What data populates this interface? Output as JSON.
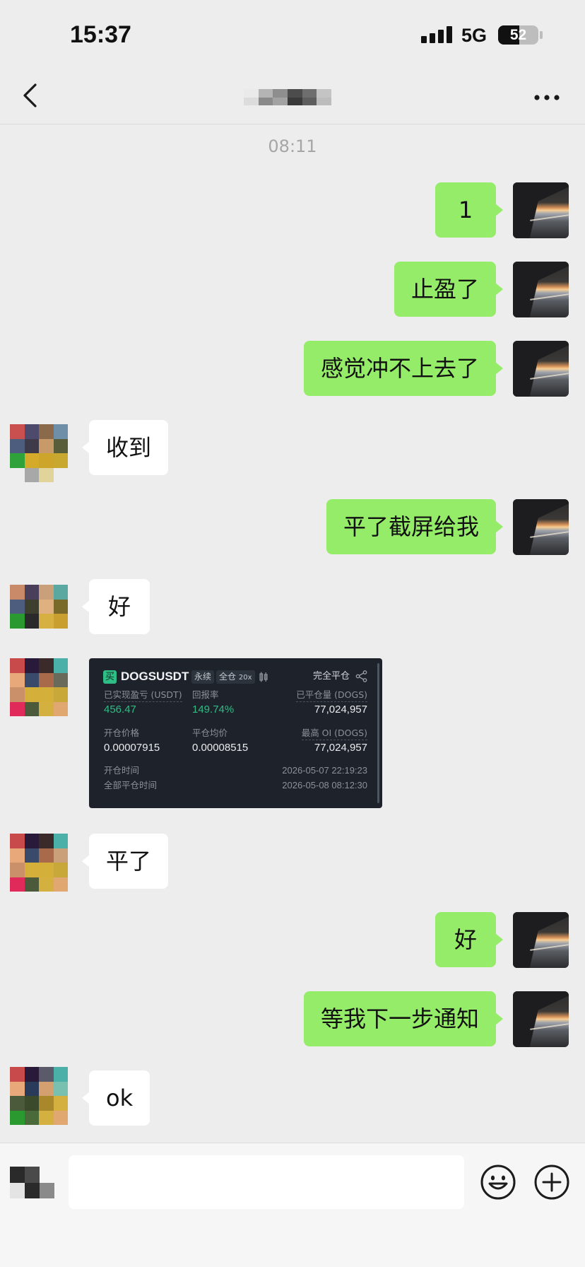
{
  "theme": {
    "background": "#ededed",
    "bubble_self": "#95ec69",
    "bubble_other": "#ffffff",
    "card_background": "#1e222a",
    "profit_color": "#2ebd85"
  },
  "status_bar": {
    "time": "15:37",
    "network": "5G",
    "battery": "52",
    "battery_level": 0.52
  },
  "nav": {
    "back_icon": "chevron-left-icon",
    "more_icon": "more-dots-icon"
  },
  "timestamp": "08:11",
  "messages": [
    "1",
    "止盈了",
    "感觉冲不上去了",
    "收到",
    "平了截屏给我",
    "好",
    "平了",
    "好",
    "等我下一步通知",
    "ok"
  ],
  "trade_card": {
    "side": "买",
    "symbol": "DOGSUSDT",
    "contract_type": "永续",
    "margin_mode": "全仓",
    "leverage": "20x",
    "status": "完全平仓",
    "realized_pnl_label": "已实现盈亏 (USDT)",
    "realized_pnl": "456.47",
    "roi_label": "回报率",
    "roi": "149.74%",
    "closed_qty_label": "已平仓量 (DOGS)",
    "closed_qty": "77,024,957",
    "entry_price_label": "开仓价格",
    "entry_price": "0.00007915",
    "exit_price_label": "平仓均价",
    "exit_price": "0.00008515",
    "max_oi_label": "最高 OI (DOGS)",
    "max_oi": "77,024,957",
    "open_time_label": "开仓时间",
    "open_time": "2026-05-07 22:19:23",
    "close_time_label": "全部平仓时间",
    "close_time": "2026-05-08 08:12:30"
  },
  "input_bar": {
    "voice_icon": "voice-icon",
    "emoji_icon": "emoji-icon",
    "plus_icon": "plus-icon",
    "input_value": ""
  }
}
